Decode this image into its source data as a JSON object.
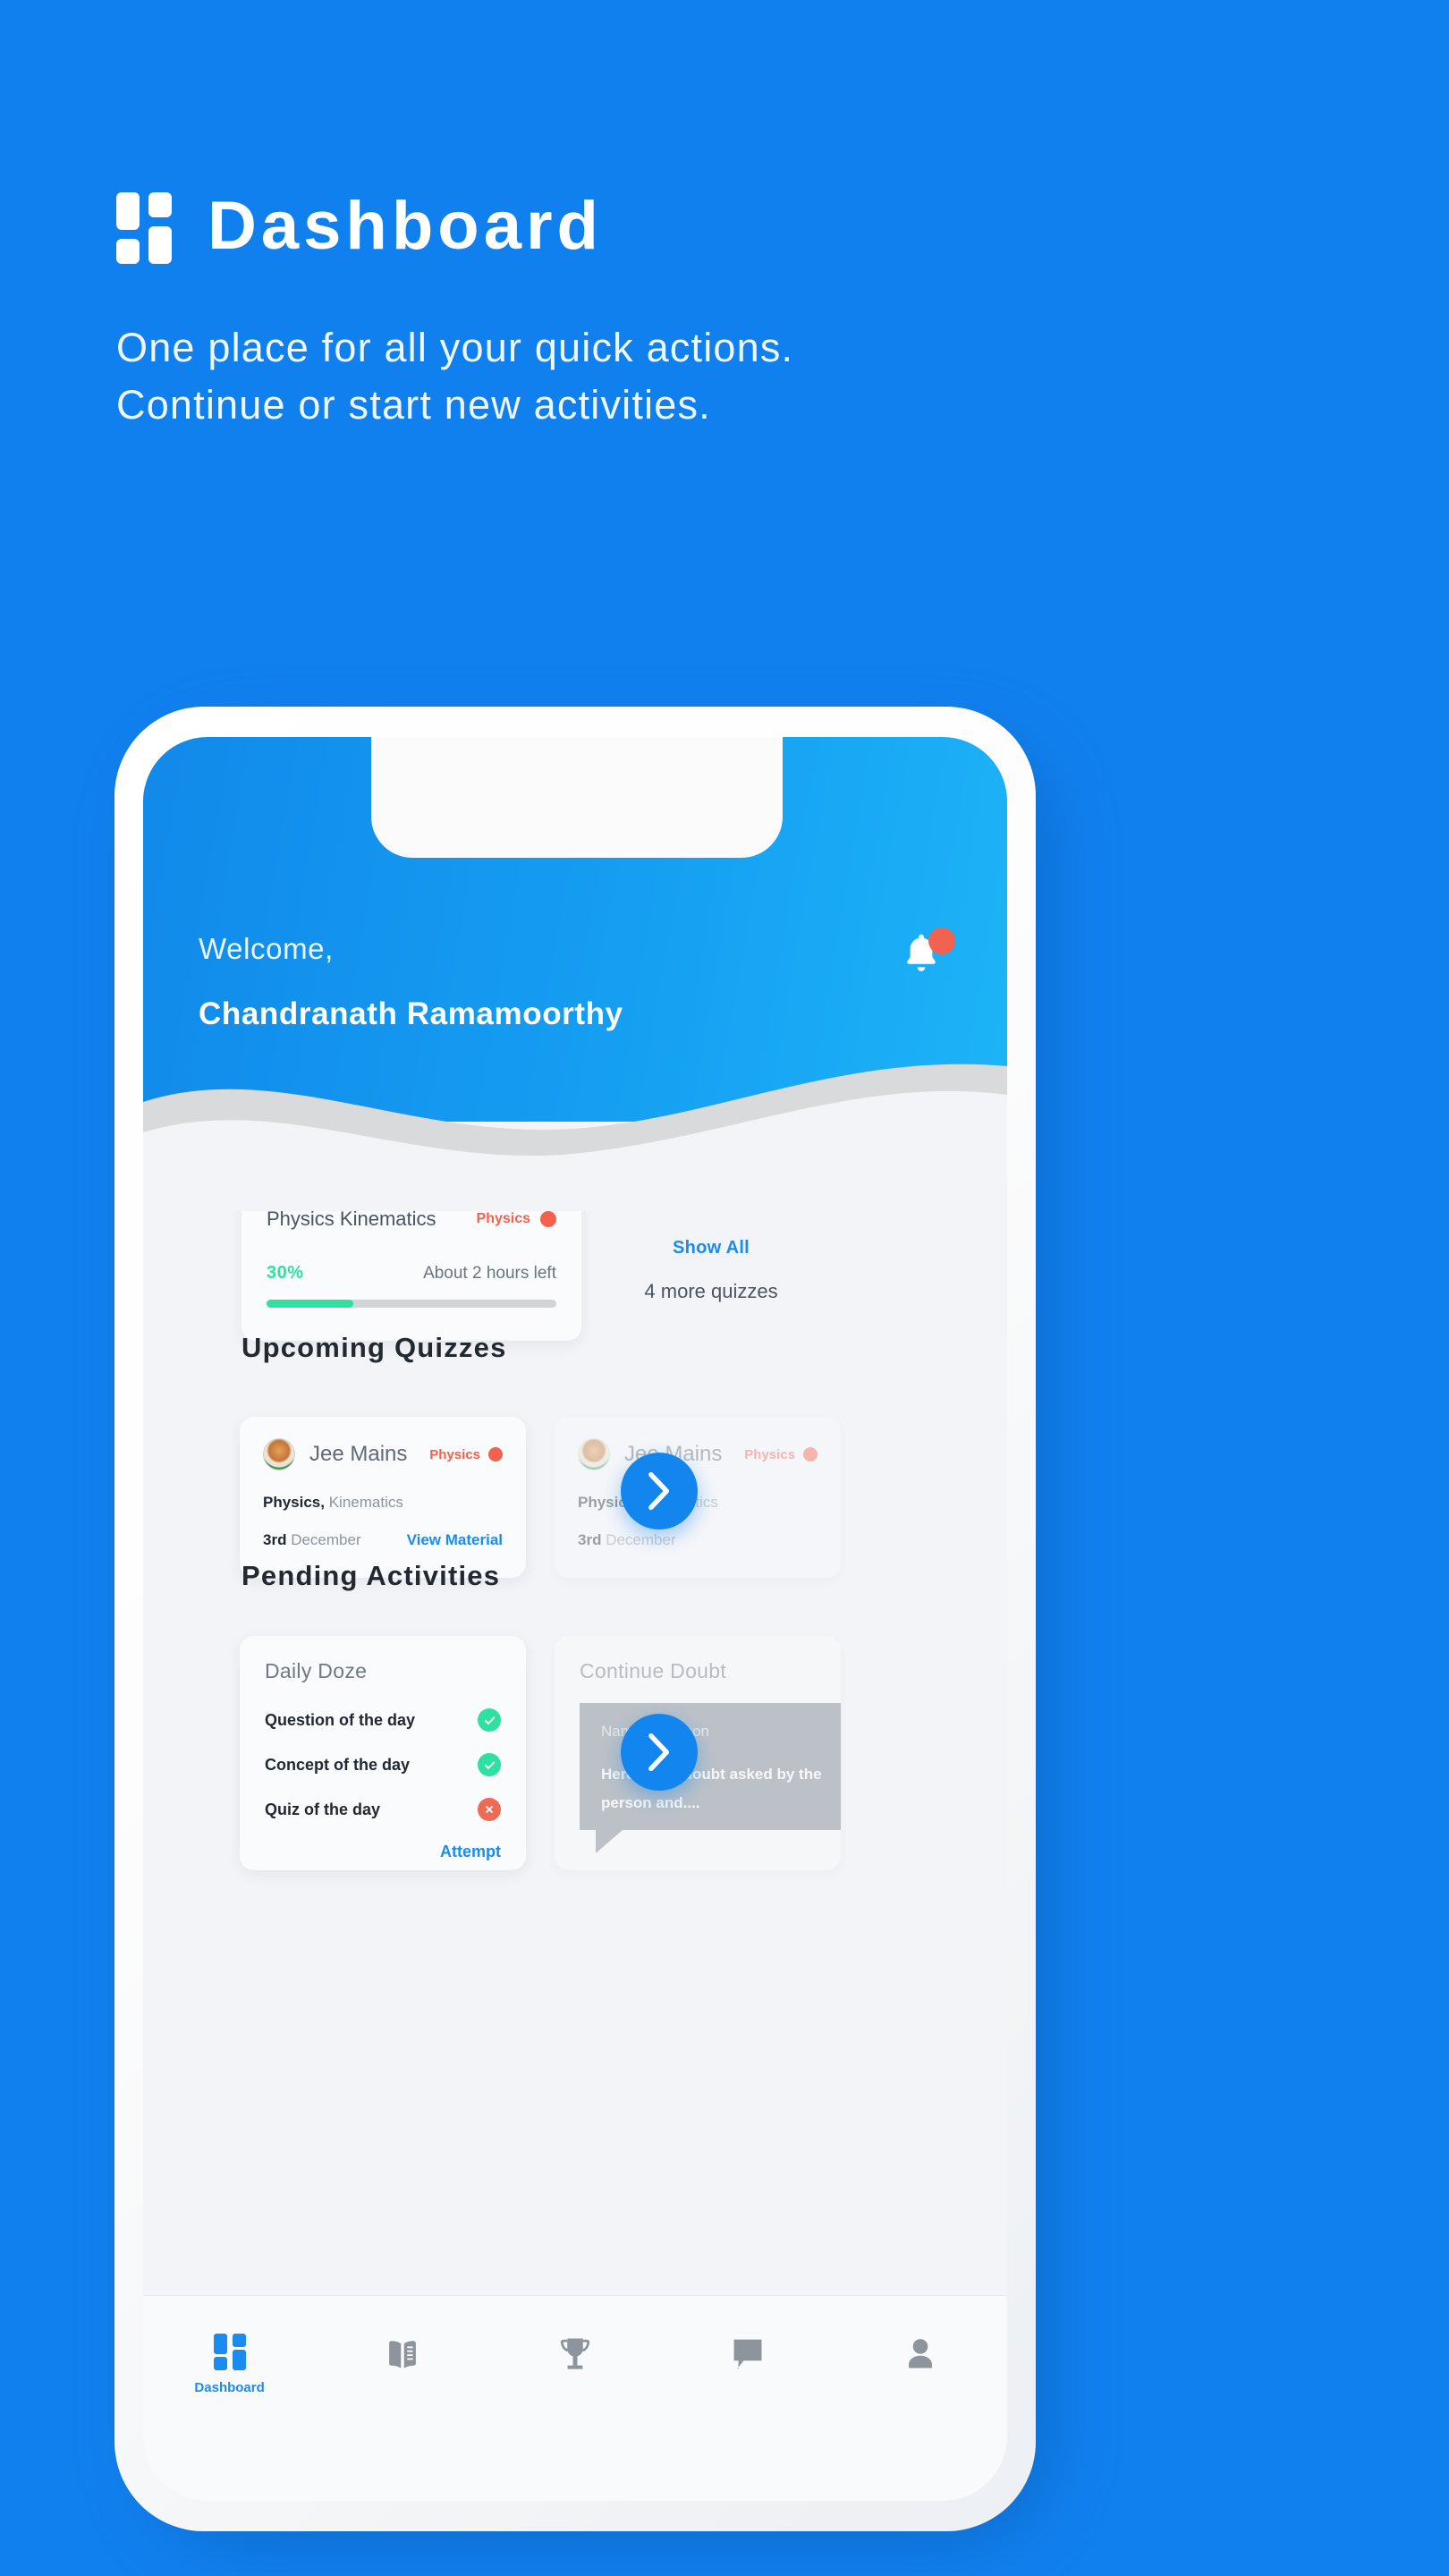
{
  "hero": {
    "logo_icon": "dashboard-grid-icon",
    "title": "Dashboard",
    "subtitle_line1": "One place for all your quick actions.",
    "subtitle_line2": "Continue or start new activities.",
    "background_color": "#1180ef",
    "text_color": "#ffffff"
  },
  "phone": {
    "header": {
      "greeting": "Welcome,",
      "user_name": "Chandranath Ramamoorthy",
      "bell_icon": "notification-bell-icon",
      "bell_has_badge": true,
      "badge_color": "#f2624e",
      "gradient_from": "#1189ea",
      "gradient_to": "#1db4f7"
    },
    "progress_card": {
      "title": "Physics Kinematics",
      "tag_label": "Physics",
      "tag_color": "#f2624e",
      "percent_label": "30%",
      "percent_value": 30,
      "time_left": "About 2 hours left",
      "progress_color": "#2ee1a0",
      "track_color": "#d2d5d8"
    },
    "show_all": {
      "link_label": "Show All",
      "count_label": "4 more quizzes",
      "link_color": "#1a8cf0"
    },
    "upcoming_quizzes": {
      "section_title": "Upcoming Quizzes",
      "cards": [
        {
          "avatar_icon": "jee-emblem-icon",
          "exam_name": "Jee Mains",
          "tag_label": "Physics",
          "topic_bold": "Physics,",
          "topic_rest": " Kinematics",
          "date_bold": "3rd",
          "date_rest": " December",
          "action_label": "View Material"
        },
        {
          "avatar_icon": "jee-emblem-icon",
          "exam_name": "Jee Mains",
          "tag_label": "Physics",
          "topic_bold": "Physics,",
          "topic_rest": " Kinematics",
          "date_bold": "3rd",
          "date_rest": " December",
          "action_label": ""
        }
      ],
      "next_button_icon": "chevron-right-icon"
    },
    "pending_activities": {
      "section_title": "Pending Activities",
      "daily_doze": {
        "title": "Daily Doze",
        "items": [
          {
            "label": "Question of the day",
            "status": "done",
            "status_icon": "check-circle-icon"
          },
          {
            "label": "Concept of the day",
            "status": "done",
            "status_icon": "check-circle-icon"
          },
          {
            "label": "Quiz of the day",
            "status": "missing",
            "status_icon": "cross-circle-icon"
          }
        ],
        "action_label": "Attempt",
        "done_color": "#2ee1a0",
        "missing_color": "#ef6a52"
      },
      "continue_doubt": {
        "title": "Continue Doubt",
        "bubble_name": "Name of person",
        "bubble_text": "Here is the doubt asked by the person and....",
        "bubble_color": "#7b848f"
      },
      "next_button_icon": "chevron-right-icon"
    },
    "bottom_nav": {
      "active_index": 0,
      "items": [
        {
          "icon": "dashboard-grid-icon",
          "label": "Dashboard",
          "active": true
        },
        {
          "icon": "book-icon",
          "label": "",
          "active": false
        },
        {
          "icon": "trophy-icon",
          "label": "",
          "active": false
        },
        {
          "icon": "chat-icon",
          "label": "",
          "active": false
        },
        {
          "icon": "person-icon",
          "label": "",
          "active": false
        }
      ],
      "active_color": "#1a8cf0",
      "inactive_color": "#8d949c"
    }
  }
}
